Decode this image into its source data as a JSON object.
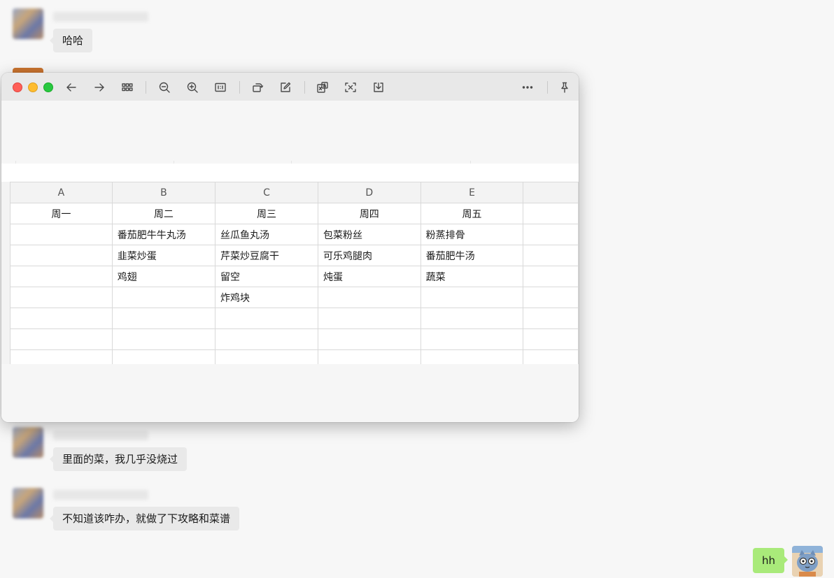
{
  "chat": {
    "messages": [
      {
        "text": "哈哈"
      },
      {
        "text": "里面的菜，我几乎没烧过"
      },
      {
        "text": "不知道该咋办，就做了下攻略和菜谱"
      }
    ],
    "my_message": {
      "text": "hh"
    }
  },
  "viewer": {
    "toolbar_icons": [
      "arrow-left-icon",
      "arrow-right-icon",
      "grid-icon",
      "zoom-out-icon",
      "zoom-in-icon",
      "actual-size-icon",
      "rotate-icon",
      "edit-icon",
      "translate-icon",
      "ocr-icon",
      "download-icon",
      "more-icon",
      "pin-icon"
    ],
    "spreadsheet": {
      "columns": [
        "A",
        "B",
        "C",
        "D",
        "E"
      ],
      "header_row": [
        "周一",
        "周二",
        "周三",
        "周四",
        "周五"
      ],
      "rows": [
        [
          "",
          "番茄肥牛牛丸汤",
          "丝瓜鱼丸汤",
          "包菜粉丝",
          "粉蒸排骨"
        ],
        [
          "",
          "韭菜炒蛋",
          "芹菜炒豆腐干",
          "可乐鸡腿肉",
          "番茄肥牛汤"
        ],
        [
          "",
          "鸡翅",
          "留空",
          "炖蛋",
          "蔬菜"
        ],
        [
          "",
          "",
          "炸鸡块",
          "",
          ""
        ]
      ]
    }
  },
  "colors": {
    "close": "#ff5f57",
    "minimize": "#febc2e",
    "maximize": "#28c840",
    "my_bubble": "#a9ea7a"
  }
}
